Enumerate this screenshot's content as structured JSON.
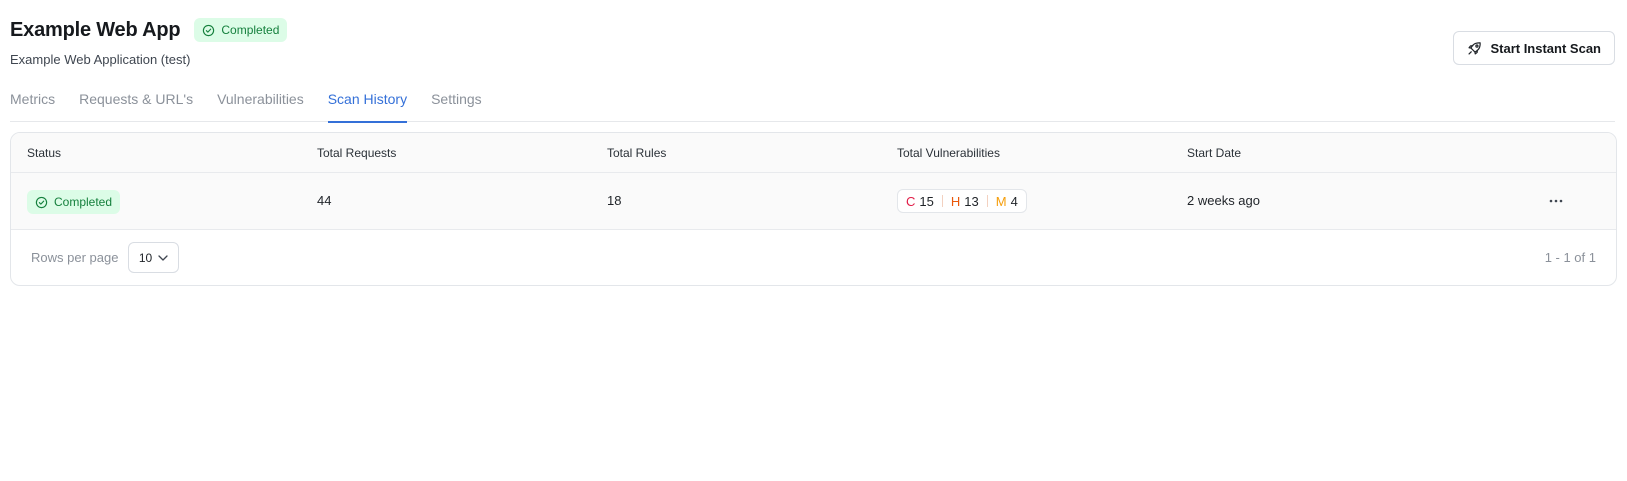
{
  "header": {
    "title": "Example Web App",
    "status_badge": "Completed",
    "subtitle": "Example Web Application (test)"
  },
  "actions": {
    "instant_scan_label": "Start Instant Scan"
  },
  "tabs": [
    {
      "label": "Metrics",
      "active": false
    },
    {
      "label": "Requests & URL's",
      "active": false
    },
    {
      "label": "Vulnerabilities",
      "active": false
    },
    {
      "label": "Scan History",
      "active": true
    },
    {
      "label": "Settings",
      "active": false
    }
  ],
  "table": {
    "columns": [
      "Status",
      "Total Requests",
      "Total Rules",
      "Total Vulnerabilities",
      "Start Date"
    ],
    "rows": [
      {
        "status": "Completed",
        "total_requests": "44",
        "total_rules": "18",
        "vulnerabilities": {
          "critical_label": "C",
          "critical": "15",
          "high_label": "H",
          "high": "13",
          "medium_label": "M",
          "medium": "4"
        },
        "start_date": "2 weeks ago"
      }
    ]
  },
  "footer": {
    "rows_per_page_label": "Rows per page",
    "rows_per_page_value": "10",
    "pagination_info": "1 - 1 of 1"
  },
  "colors": {
    "accent": "#3470d8",
    "success_bg": "#dcfce7",
    "success_text": "#15803d",
    "critical": "#e11d48",
    "high": "#ea580c",
    "medium": "#f59e0b"
  },
  "icons": {
    "status": "check-circle-icon",
    "instant_scan": "rocket-icon",
    "row_actions": "more-horizontal-icon",
    "select": "chevron-down-icon"
  }
}
